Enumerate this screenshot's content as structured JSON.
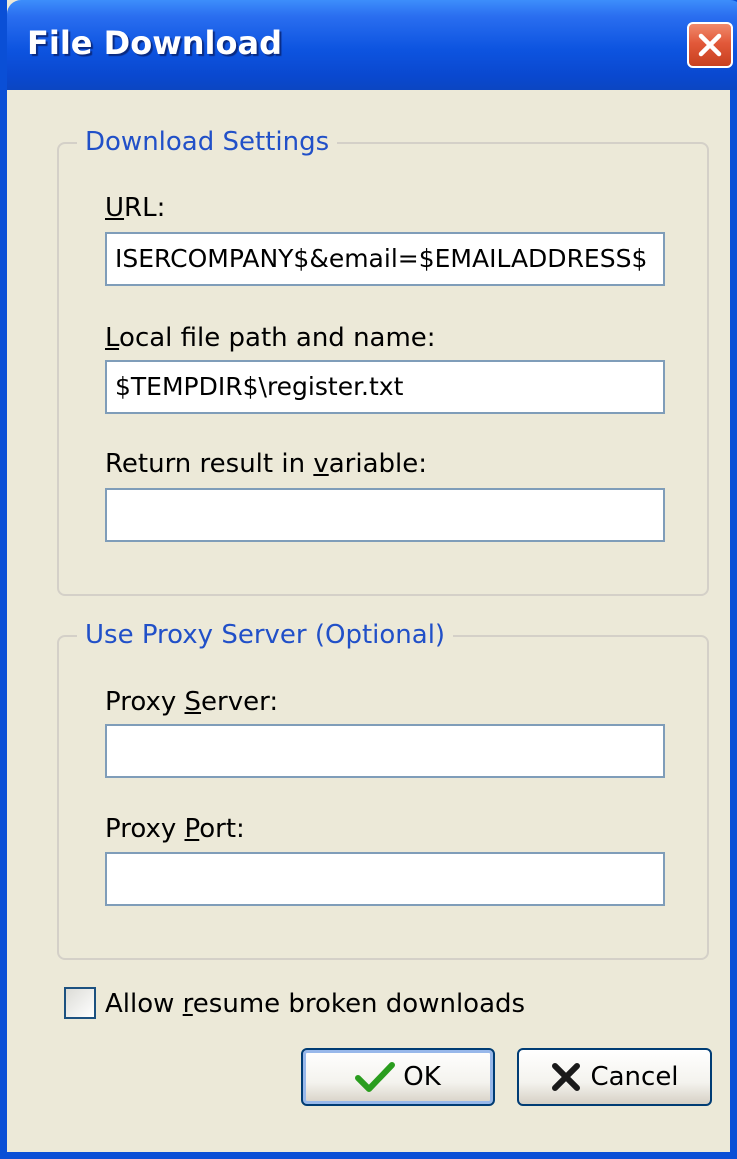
{
  "window": {
    "title": "File Download"
  },
  "download_settings": {
    "legend": "Download Settings",
    "url": {
      "label_prefix": "",
      "label_accel": "U",
      "label_rest": "RL:",
      "value": "ISERCOMPANY$&email=$EMAILADDRESS$"
    },
    "local_path": {
      "label_prefix": "",
      "label_accel": "L",
      "label_rest": "ocal file path and name:",
      "value": "$TEMPDIR$\\register.txt"
    },
    "return_variable": {
      "label_prefix": "Return result in ",
      "label_accel": "v",
      "label_rest": "ariable:",
      "value": ""
    }
  },
  "proxy": {
    "legend": "Use Proxy Server (Optional)",
    "server": {
      "label_prefix": "Proxy ",
      "label_accel": "S",
      "label_rest": "erver:",
      "value": ""
    },
    "port": {
      "label_prefix": "Proxy ",
      "label_accel": "P",
      "label_rest": "ort:",
      "value": ""
    }
  },
  "resume": {
    "label_prefix": "Allow ",
    "label_accel": "r",
    "label_rest": "esume broken downloads",
    "checked": false
  },
  "buttons": {
    "ok": {
      "label": "OK",
      "icon": "checkmark-icon",
      "color": "#2a9d1e"
    },
    "cancel": {
      "label": "Cancel",
      "icon": "x-icon",
      "color": "#1a1a1a"
    }
  },
  "colors": {
    "titlebar": "#0a4fd6",
    "legend_text": "#2150c8",
    "dialog_bg": "#ece9d8",
    "close_button": "#e2593a"
  }
}
